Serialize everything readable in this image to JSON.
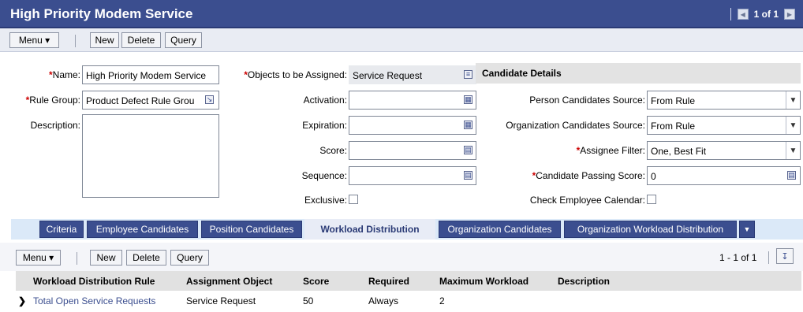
{
  "header": {
    "title": "High Priority Modem Service",
    "pager_text": "1 of 1"
  },
  "toolbar": {
    "menu_label": "Menu ▾",
    "new_label": "New",
    "delete_label": "Delete",
    "query_label": "Query"
  },
  "form": {
    "name_label": "Name:",
    "name_value": "High Priority Modem Service",
    "rule_group_label": "Rule Group:",
    "rule_group_value": "Product Defect Rule Grou",
    "description_label": "Description:",
    "objects_label": "Objects to be Assigned:",
    "objects_value": "Service Request",
    "activation_label": "Activation:",
    "expiration_label": "Expiration:",
    "score_label": "Score:",
    "sequence_label": "Sequence:",
    "exclusive_label": "Exclusive:",
    "required_marker": "*"
  },
  "candidate_details": {
    "title": "Candidate Details",
    "person_source_label": "Person Candidates Source:",
    "person_source_value": "From Rule",
    "org_source_label": "Organization Candidates Source:",
    "org_source_value": "From Rule",
    "assignee_filter_label": "Assignee Filter:",
    "assignee_filter_value": "One, Best Fit",
    "passing_score_label": "Candidate Passing Score:",
    "passing_score_value": "0",
    "check_calendar_label": "Check Employee Calendar:"
  },
  "tabs": [
    {
      "label": "Criteria"
    },
    {
      "label": "Employee Candidates"
    },
    {
      "label": "Position Candidates"
    },
    {
      "label": "Workload Distribution"
    },
    {
      "label": "Organization Candidates"
    },
    {
      "label": "Organization Workload Distribution"
    }
  ],
  "list": {
    "menu_label": "Menu ▾",
    "new_label": "New",
    "delete_label": "Delete",
    "query_label": "Query",
    "record_count": "1 - 1 of 1",
    "columns": [
      "Workload Distribution Rule",
      "Assignment Object",
      "Score",
      "Required",
      "Maximum Workload",
      "Description"
    ],
    "rows": [
      [
        "Total Open Service Requests",
        "Service Request",
        "50",
        "Always",
        "2",
        ""
      ]
    ]
  },
  "colors": {
    "header_bg": "#3b4e8f",
    "required": "#cc0000",
    "link": "#3b4e8f"
  }
}
